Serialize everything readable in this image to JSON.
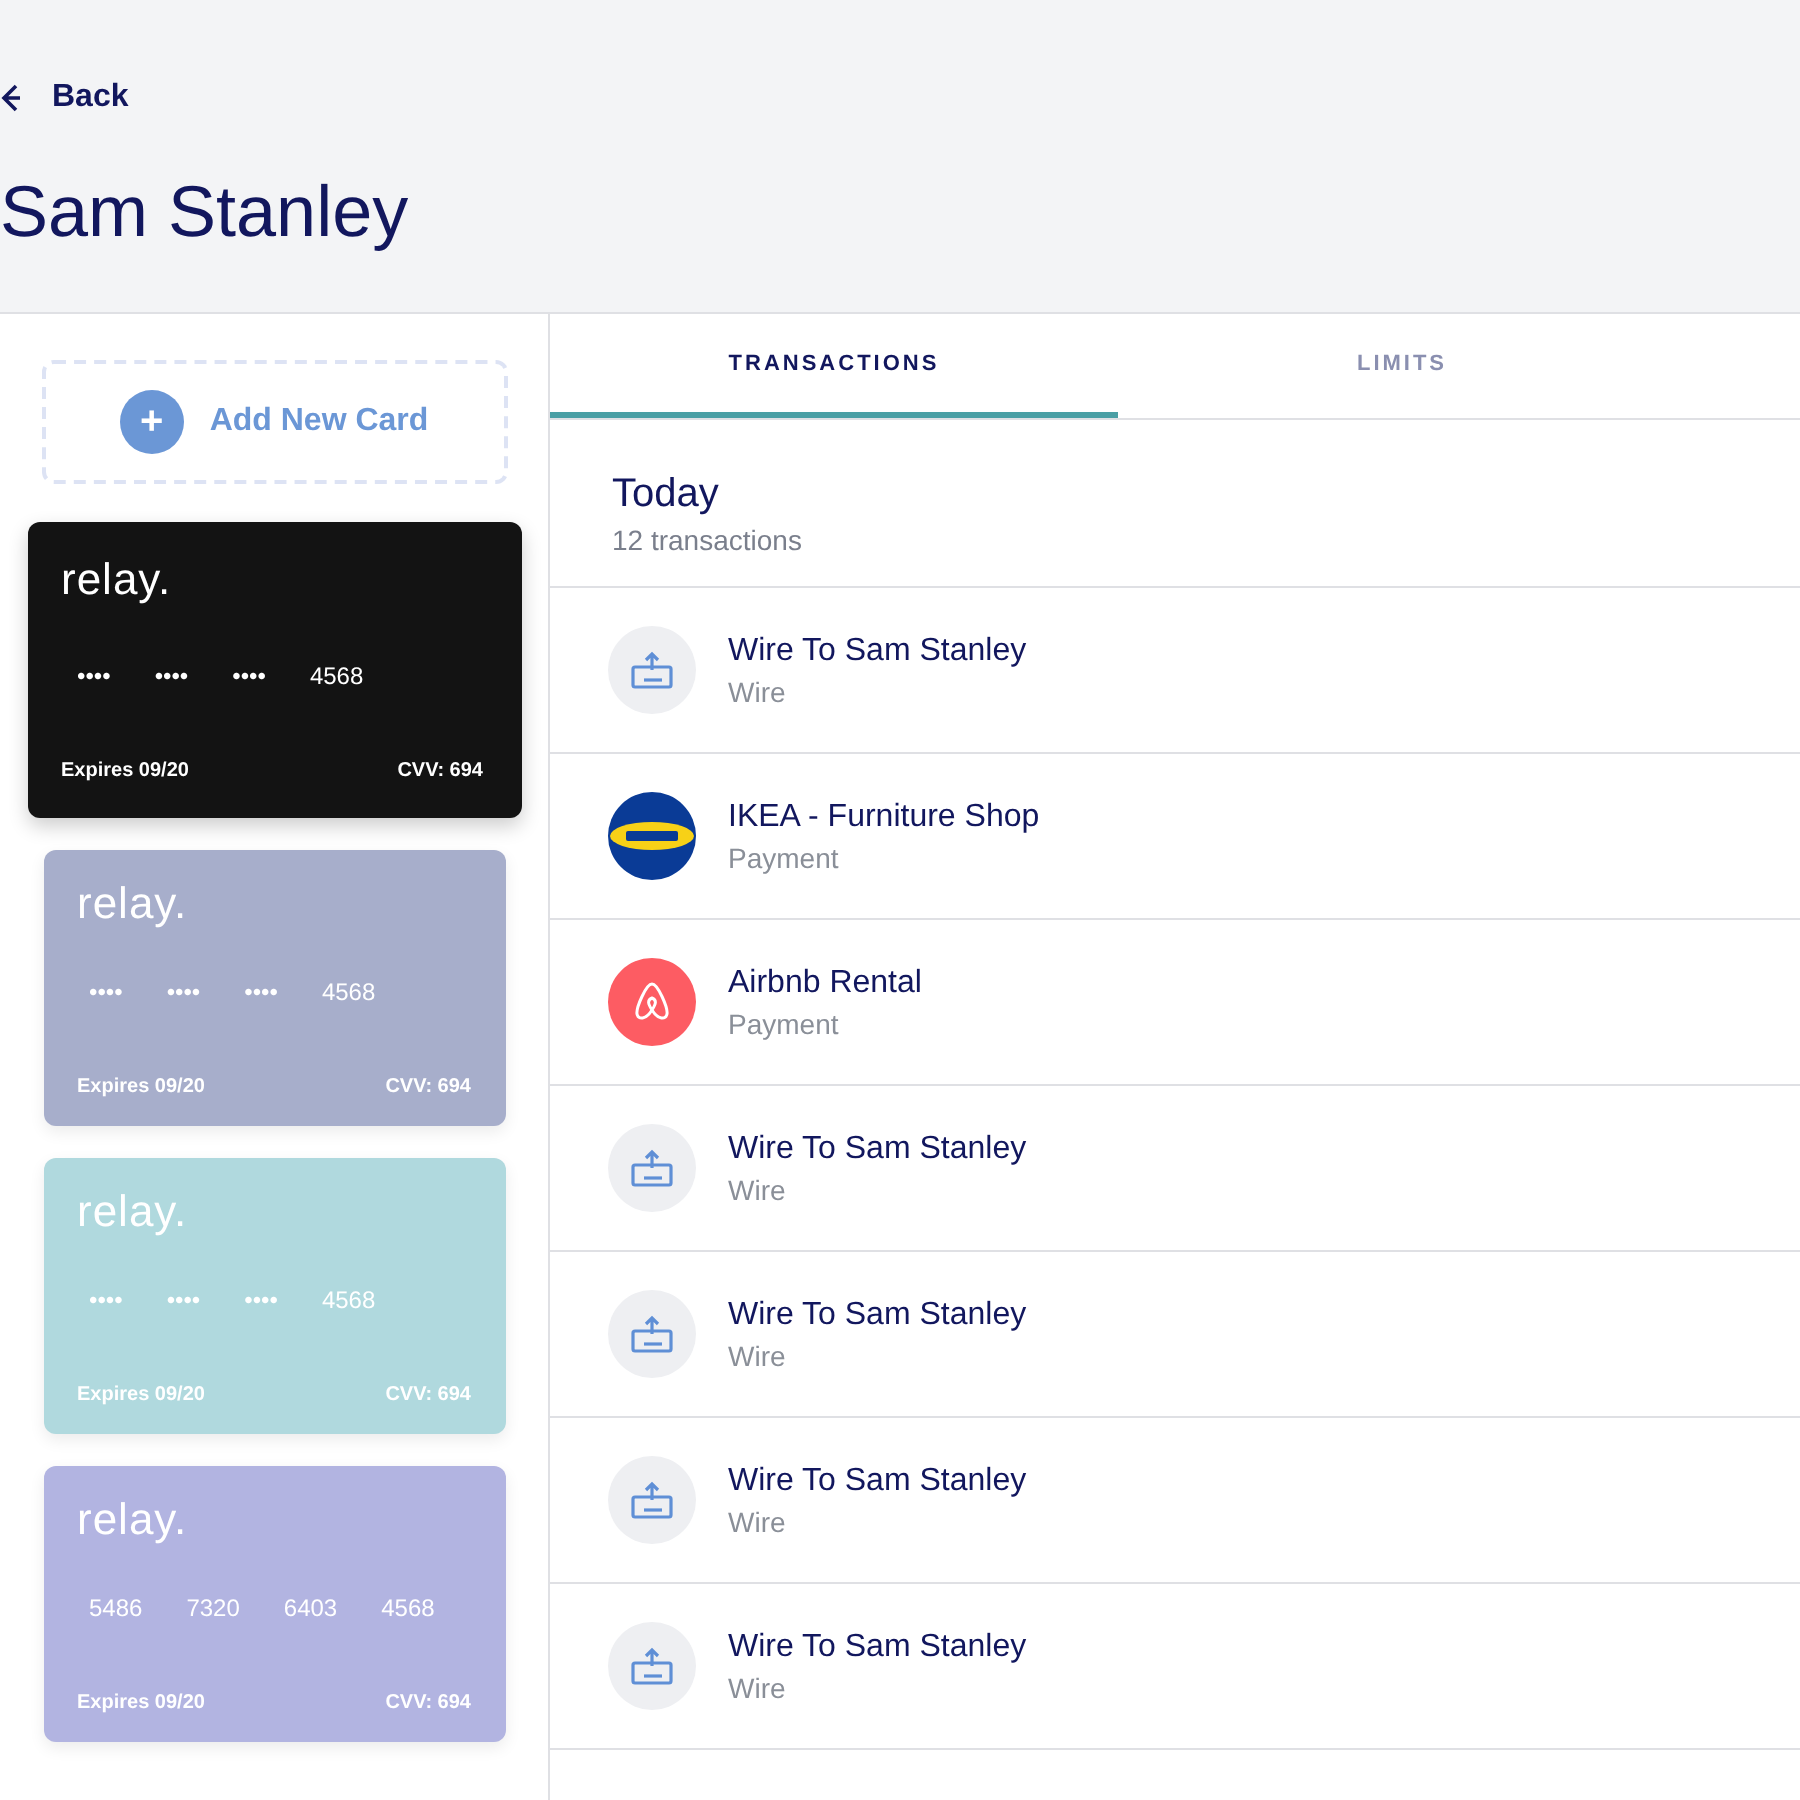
{
  "back": {
    "label": "Back"
  },
  "title": "Sam Stanley",
  "add_card": {
    "label": "Add New Card",
    "icon": "+"
  },
  "cards": [
    {
      "brand": "relay.",
      "color": "#131313",
      "selected": true,
      "number": [
        "••••",
        "••••",
        "••••",
        "4568"
      ],
      "expires": "Expires 09/20",
      "cvv": "CVV: 694"
    },
    {
      "brand": "relay.",
      "color": "#a7aecb",
      "selected": false,
      "number": [
        "••••",
        "••••",
        "••••",
        "4568"
      ],
      "expires": "Expires 09/20",
      "cvv": "CVV: 694"
    },
    {
      "brand": "relay.",
      "color": "#b0d9de",
      "selected": false,
      "number": [
        "••••",
        "••••",
        "••••",
        "4568"
      ],
      "expires": "Expires 09/20",
      "cvv": "CVV: 694"
    },
    {
      "brand": "relay.",
      "color": "#b2b4e1",
      "selected": false,
      "number": [
        "5486",
        "7320",
        "6403",
        "4568"
      ],
      "expires": "Expires 09/20",
      "cvv": "CVV: 694"
    }
  ],
  "tabs": [
    {
      "label": "TRANSACTIONS",
      "selected": true
    },
    {
      "label": "LIMITS",
      "selected": false
    }
  ],
  "group": {
    "title": "Today",
    "count": "12 transactions"
  },
  "transactions": [
    {
      "kind": "wire",
      "name": "Wire To Sam Stanley",
      "type": "Wire"
    },
    {
      "kind": "ikea",
      "name": "IKEA - Furniture Shop",
      "type": "Payment"
    },
    {
      "kind": "airbnb",
      "name": "Airbnb Rental",
      "type": "Payment"
    },
    {
      "kind": "wire",
      "name": "Wire To Sam Stanley",
      "type": "Wire"
    },
    {
      "kind": "wire",
      "name": "Wire To Sam Stanley",
      "type": "Wire"
    },
    {
      "kind": "wire",
      "name": "Wire To Sam Stanley",
      "type": "Wire"
    },
    {
      "kind": "wire",
      "name": "Wire To Sam Stanley",
      "type": "Wire"
    }
  ]
}
